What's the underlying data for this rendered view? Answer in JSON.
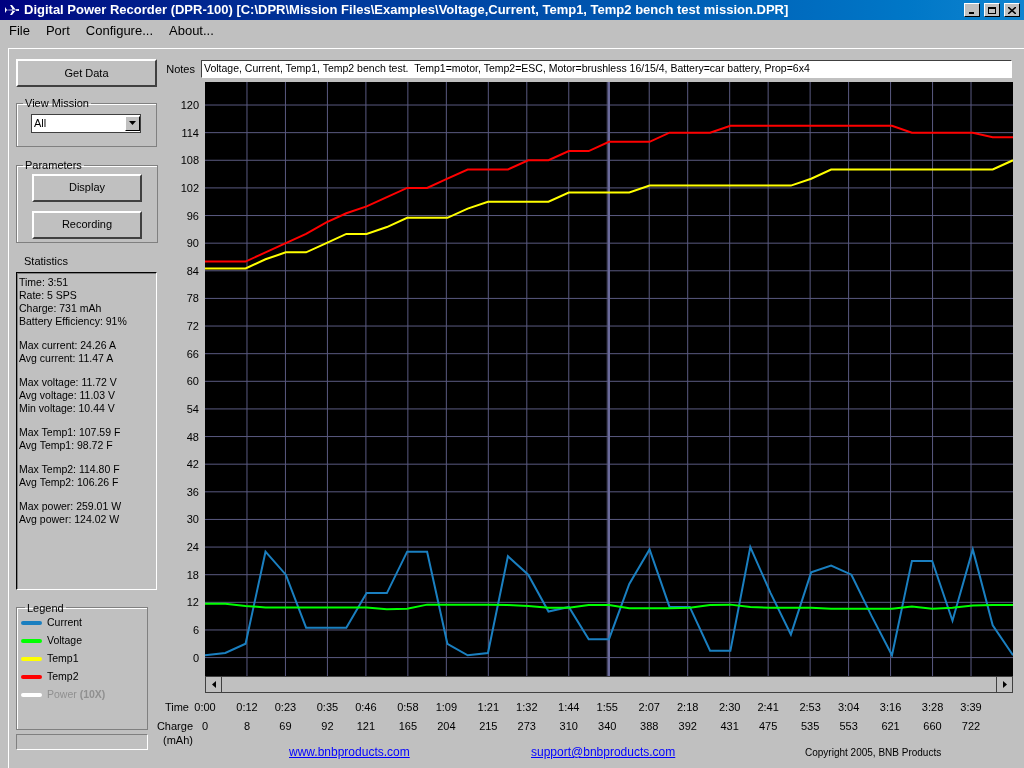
{
  "window": {
    "title": "Digital Power Recorder (DPR-100) [C:\\DPR\\Mission Files\\Examples\\Voltage,Current, Temp1, Temp2 bench test mission.DPR]"
  },
  "menu": [
    "File",
    "Port",
    "Configure...",
    "About..."
  ],
  "get_data_button": "Get Data",
  "view_mission": {
    "label": "View Mission",
    "value": "All"
  },
  "parameters": {
    "label": "Parameters",
    "buttons": [
      "Display",
      "Recording"
    ]
  },
  "statistics": {
    "label": "Statistics",
    "groups": [
      [
        "Time: 3:51",
        "Rate: 5 SPS",
        "Charge: 731 mAh",
        "Battery Efficiency: 91%"
      ],
      [
        "Max current: 24.26 A",
        "Avg current: 11.47 A"
      ],
      [
        "Max voltage: 11.72 V",
        "Avg voltage: 11.03 V",
        "Min voltage: 10.44 V"
      ],
      [
        "Max Temp1: 107.59 F",
        "Avg Temp1: 98.72 F"
      ],
      [
        "Max Temp2: 114.80 F",
        "Avg Temp2: 106.26 F"
      ],
      [
        "Max power: 259.01 W",
        "Avg power: 124.02 W"
      ]
    ]
  },
  "legend": {
    "label": "Legend",
    "items": [
      {
        "label": "Current",
        "color": "#1a7fc0",
        "disabled": false
      },
      {
        "label": "Voltage",
        "color": "#00ff00",
        "disabled": false
      },
      {
        "label": "Temp1",
        "color": "#ffff00",
        "disabled": false
      },
      {
        "label": "Temp2",
        "color": "#ff0000",
        "disabled": false
      },
      {
        "label": "Power **(10X)**",
        "color": "#ffffff",
        "disabled": true
      }
    ]
  },
  "notes": {
    "label": "Notes",
    "value": "Voltage, Current, Temp1, Temp2 bench test.  Temp1=motor, Temp2=ESC, Motor=brushless 16/15/4, Battery=car battery, Prop=6x4"
  },
  "chart": {
    "time_label": "Time",
    "charge_label": "Charge",
    "charge_unit": "(mAh)",
    "charge_values": [
      "0",
      "8",
      "69",
      "92",
      "121",
      "165",
      "204",
      "215",
      "273",
      "310",
      "340",
      "388",
      "392",
      "431",
      "475",
      "535",
      "553",
      "621",
      "660",
      "722"
    ],
    "chart_data": {
      "type": "line",
      "x": [
        0,
        5.8,
        11.6,
        17.3,
        23.1,
        28.9,
        34.7,
        40.4,
        46.2,
        52,
        57.8,
        63.5,
        69.3,
        75.1,
        80.9,
        86.6,
        92.4,
        98.2,
        104,
        109.7,
        115.5,
        121.3,
        127.1,
        132.8,
        138.6,
        144.4,
        150.2,
        155.9,
        161.7,
        167.5,
        173.3,
        179,
        184.8,
        190.6,
        196.4,
        202.1,
        207.9,
        213.7,
        219.5,
        225.2,
        231
      ],
      "xlim": [
        0,
        231
      ],
      "ylim": [
        -4,
        125
      ],
      "grid": true,
      "ref_lines": [
        {
          "axis": "x",
          "value": 115.5
        }
      ],
      "yticks": [
        0,
        6,
        12,
        18,
        24,
        30,
        36,
        42,
        48,
        54,
        60,
        66,
        72,
        78,
        84,
        90,
        96,
        102,
        108,
        114,
        120
      ],
      "xticks": [
        {
          "value": 0,
          "label": "0:00"
        },
        {
          "value": 12,
          "label": "0:12"
        },
        {
          "value": 23,
          "label": "0:23"
        },
        {
          "value": 35,
          "label": "0:35"
        },
        {
          "value": 46,
          "label": "0:46"
        },
        {
          "value": 58,
          "label": "0:58"
        },
        {
          "value": 69,
          "label": "1:09"
        },
        {
          "value": 81,
          "label": "1:21"
        },
        {
          "value": 92,
          "label": "1:32"
        },
        {
          "value": 104,
          "label": "1:44"
        },
        {
          "value": 115,
          "label": "1:55"
        },
        {
          "value": 127,
          "label": "2:07"
        },
        {
          "value": 138,
          "label": "2:18"
        },
        {
          "value": 150,
          "label": "2:30"
        },
        {
          "value": 161,
          "label": "2:41"
        },
        {
          "value": 173,
          "label": "2:53"
        },
        {
          "value": 184,
          "label": "3:04"
        },
        {
          "value": 196,
          "label": "3:16"
        },
        {
          "value": 208,
          "label": "3:28"
        },
        {
          "value": 219,
          "label": "3:39"
        }
      ],
      "series": [
        {
          "color": "#1a7fc0",
          "values": [
            0.5,
            1,
            3,
            23,
            18,
            6.5,
            6.5,
            6.5,
            14,
            14,
            23,
            23,
            3,
            0.5,
            1,
            22,
            18,
            10,
            11,
            4,
            4,
            16,
            23.5,
            11,
            11,
            1.5,
            1.5,
            24,
            14,
            5,
            18.5,
            20,
            18,
            9,
            0.5,
            21,
            21,
            8,
            23.5,
            7,
            0.5
          ]
        },
        {
          "color": "#00ff00",
          "values": [
            11.7,
            11.7,
            11.2,
            10.9,
            10.9,
            10.9,
            10.9,
            10.9,
            10.9,
            10.5,
            10.6,
            11.5,
            11.5,
            11.5,
            11.5,
            11.4,
            11.2,
            10.8,
            10.8,
            11.4,
            11.4,
            10.7,
            10.7,
            10.7,
            10.8,
            11.4,
            11.5,
            11,
            10.8,
            10.8,
            10.8,
            10.6,
            10.6,
            10.6,
            10.6,
            11.1,
            10.6,
            10.8,
            11.3,
            11.4,
            11.4
          ]
        },
        {
          "color": "#ffff00",
          "values": [
            84.5,
            84.5,
            84.5,
            86.5,
            88,
            88,
            90,
            92,
            92,
            93.5,
            95.5,
            95.5,
            95.5,
            97.5,
            99,
            99,
            99,
            99,
            101,
            101,
            101,
            101,
            102.5,
            102.5,
            102.5,
            102.5,
            102.5,
            102.5,
            102.5,
            102.5,
            104,
            106,
            106,
            106,
            106,
            106,
            106,
            106,
            106,
            106,
            108
          ]
        },
        {
          "color": "#ff0000",
          "values": [
            86,
            86,
            86,
            88,
            90,
            92,
            94.5,
            96.5,
            98,
            100,
            102,
            102,
            104,
            106,
            106,
            106,
            108,
            108,
            110,
            110,
            112,
            112,
            112,
            114,
            114,
            114,
            115.5,
            115.5,
            115.5,
            115.5,
            115.5,
            115.5,
            115.5,
            115.5,
            115.5,
            114,
            114,
            114,
            114,
            113,
            113
          ]
        }
      ]
    }
  },
  "footer": {
    "links": [
      "www.bnbproducts.com",
      "support@bnbproducts.com"
    ],
    "copyright": "Copyright 2005, BNB Products"
  }
}
